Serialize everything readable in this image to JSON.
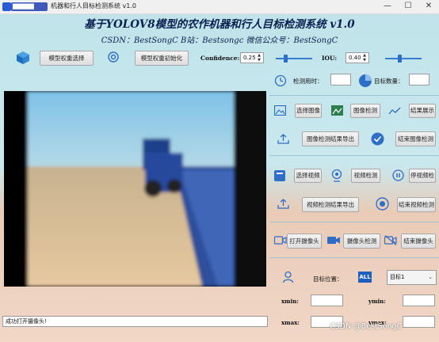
{
  "window": {
    "title": "机器和行人目标检测系统 v1.0",
    "controls": {
      "minimize": "—",
      "maximize": "☐",
      "close": "✕"
    }
  },
  "header": {
    "title": "基于YOLOV8模型的农作机器和行人目标检测系统 v1.0",
    "subtitle": "CSDN：BestSongC   B站：Bestsongc   微信公众号：BestSongC"
  },
  "toolbar": {
    "select_weights": "模型权重选择",
    "init_weights": "模型权重初始化",
    "confidence_label": "Confidence:",
    "confidence_value": "0.25",
    "confidence_level": 0.25,
    "iou_label": "IOU:",
    "iou_value": "0.40",
    "iou_level": 0.4
  },
  "stats": {
    "time_label": "检测用时：",
    "time_value": "",
    "count_label": "目标数量：",
    "count_value": ""
  },
  "image_section": {
    "select_image": "选择图像",
    "detect_image": "图像检测",
    "show_result": "结果展示",
    "export_result": "图像检测结果导出",
    "end_detect": "结束图像检测"
  },
  "video_section": {
    "select_video": "选择视频",
    "detect_video": "视频检测",
    "stop_detect": "停视频检",
    "export_result": "视频检测结果导出",
    "end_detect": "结束视频检测"
  },
  "camera_section": {
    "open_camera": "打开摄像头",
    "detect_camera": "摄像头检测",
    "end_camera": "结束摄像头"
  },
  "target": {
    "position_label": "目标位置：",
    "all_badge": "ALL",
    "selected": "目标1",
    "xmin_label": "xmin:",
    "xmax_label": "xmax:",
    "ymin_label": "ymin:",
    "ymax_label": "ymax:"
  },
  "status_bar": {
    "message": "成功打开摄像头!"
  },
  "watermark": "CSDN @BestSongC",
  "colors": {
    "accent": "#2f6ec7",
    "title": "#0b1f4f"
  }
}
